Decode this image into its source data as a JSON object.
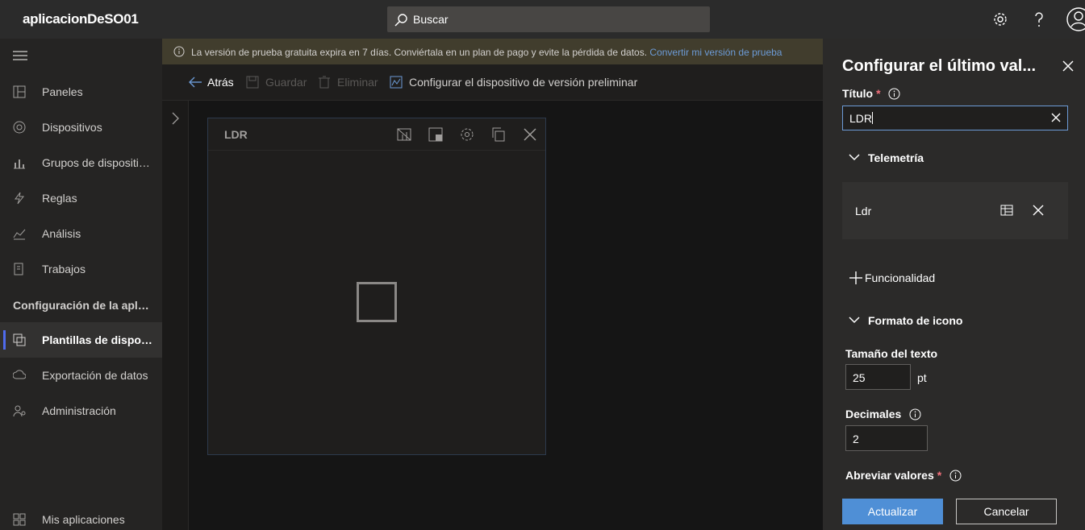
{
  "topbar": {
    "app_title": "aplicacionDeSO01",
    "search_placeholder": "Buscar",
    "icons": [
      "gear-icon",
      "help-icon",
      "user-avatar-icon"
    ]
  },
  "sidebar": {
    "items": [
      {
        "label": "Paneles",
        "icon": "dashboard-icon"
      },
      {
        "label": "Dispositivos",
        "icon": "devices-icon"
      },
      {
        "label": "Grupos de dispositivos",
        "icon": "device-groups-icon"
      },
      {
        "label": "Reglas",
        "icon": "rules-icon"
      },
      {
        "label": "Análisis",
        "icon": "analytics-icon"
      },
      {
        "label": "Trabajos",
        "icon": "jobs-icon"
      }
    ],
    "section_title": "Configuración de la aplicación",
    "config_items": [
      {
        "label": "Plantillas de dispositivo",
        "icon": "device-templates-icon",
        "active": true
      },
      {
        "label": "Exportación de datos",
        "icon": "data-export-icon"
      },
      {
        "label": "Administración",
        "icon": "administration-icon"
      }
    ],
    "footer_item": {
      "label": "Mis aplicaciones",
      "icon": "my-apps-icon"
    }
  },
  "banner": {
    "text": "La versión de prueba gratuita expira en 7 días. Conviértala en un plan de pago y evite la pérdida de datos.",
    "link": "Convertir mi versión de prueba"
  },
  "commandbar": {
    "back": "Atrás",
    "save": "Guardar",
    "delete": "Eliminar",
    "configure_preview": "Configurar el dispositivo de versión preliminar"
  },
  "tile": {
    "title": "LDR"
  },
  "panel": {
    "title": "Configurar el último val...",
    "title_label": "Título",
    "title_value": "LDR",
    "telemetry_section": "Telemetría",
    "telemetry_item": "Ldr",
    "add_capability": "Funcionalidad",
    "tile_format_section": "Formato de icono",
    "text_size_label": "Tamaño del texto",
    "text_size_value": "25",
    "text_size_unit": "pt",
    "decimals_label": "Decimales",
    "decimals_value": "2",
    "abbreviate_label": "Abreviar valores",
    "update_button": "Actualizar",
    "cancel_button": "Cancelar"
  },
  "colors": {
    "accent": "#4f8fd6",
    "banner_bg": "#413d2d",
    "required": "#f1707b"
  }
}
